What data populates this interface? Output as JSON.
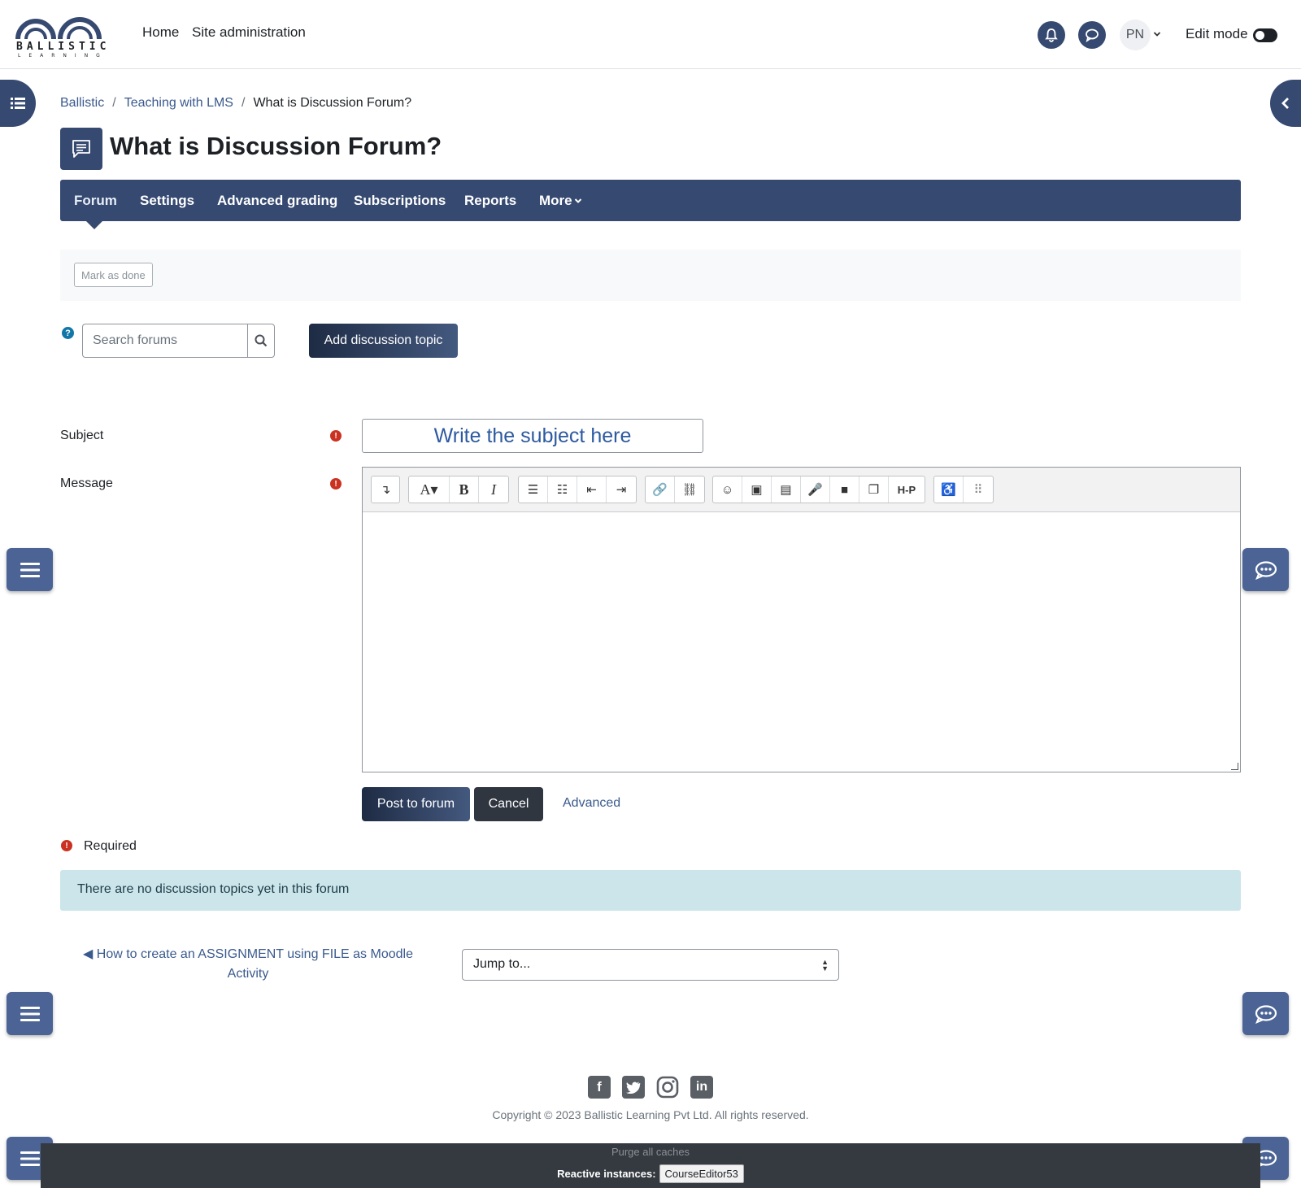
{
  "brand": {
    "name": "BALLISTIC",
    "tagline": "LEARNING"
  },
  "topnav": {
    "links": [
      "Home",
      "Site administration"
    ],
    "user_initials": "PN",
    "edit_mode_label": "Edit mode"
  },
  "breadcrumb": [
    "Ballistic",
    "Teaching with LMS",
    "What is Discussion Forum?"
  ],
  "page_title": "What is Discussion Forum?",
  "secondary_nav": {
    "tabs": [
      "Forum",
      "Settings",
      "Advanced grading",
      "Subscriptions",
      "Reports",
      "More"
    ],
    "active": "Forum"
  },
  "activity": {
    "mark_done_label": "Mark as done"
  },
  "search": {
    "placeholder": "Search forums"
  },
  "add_topic_label": "Add discussion topic",
  "form": {
    "subject_label": "Subject",
    "subject_value": "Write the subject here",
    "message_label": "Message",
    "post_label": "Post to forum",
    "cancel_label": "Cancel",
    "advanced_label": "Advanced",
    "required_label": "Required"
  },
  "toolbar_icons": [
    "toolbar-toggle-icon",
    "font-style-icon",
    "bold-icon",
    "italic-icon",
    "unordered-list-icon",
    "ordered-list-icon",
    "outdent-icon",
    "indent-icon",
    "link-icon",
    "unlink-icon",
    "emoji-icon",
    "image-icon",
    "media-file-icon",
    "record-audio-icon",
    "record-video-icon",
    "manage-files-icon",
    "h5p-icon",
    "accessibility-checker-icon",
    "screenreader-helper-icon"
  ],
  "alert": {
    "text": "There are no discussion topics yet in this forum"
  },
  "activity_nav": {
    "prev_link": "◀ How to create an ASSIGNMENT using FILE as Moodle Activity",
    "jump_placeholder": "Jump to..."
  },
  "footer": {
    "social": [
      "facebook-icon",
      "twitter-icon",
      "instagram-icon",
      "linkedin-icon"
    ],
    "copyright": "Copyright © 2023 Ballistic Learning Pvt Ltd. All rights reserved.",
    "purge_label": "Purge all caches",
    "reactive_label": "Reactive instances:",
    "reactive_instance": "CourseEditor53"
  },
  "colors": {
    "primary": "#364971",
    "danger": "#ca3120",
    "info_bg": "#cbe5ea",
    "footer_bg": "#343a40"
  }
}
